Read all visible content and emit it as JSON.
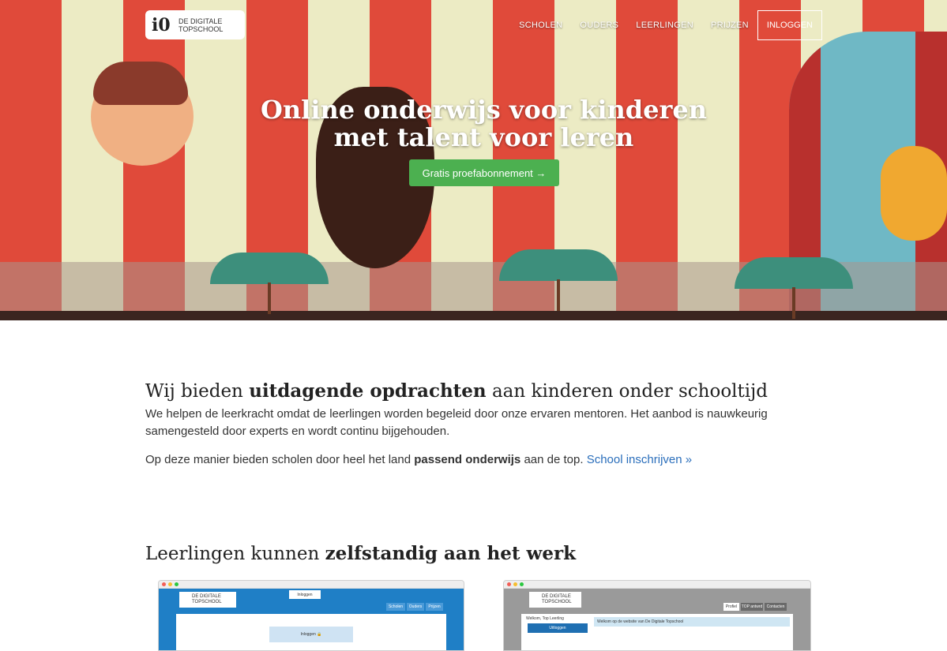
{
  "header": {
    "logo_mark": "i0",
    "logo_line1": "DE DIGITALE",
    "logo_line2": "TOPSCHOOL",
    "nav": [
      "SCHOLEN",
      "OUDERS",
      "LEERLINGEN",
      "PRIJZEN"
    ],
    "login_label": "INLOGGEN"
  },
  "hero": {
    "title": "Online onderwijs voor kinderen met talent voor leren",
    "cta_label": "Gratis proefabonnement →"
  },
  "section1": {
    "heading_pre": "Wij bieden ",
    "heading_bold": "uitdagende opdrachten",
    "heading_post": " aan kinderen onder schooltijd",
    "paragraph1": "We helpen de leerkracht omdat de leerlingen worden begeleid door onze ervaren mentoren. Het aanbod is nauwkeurig samengesteld door experts en wordt continu bijgehouden.",
    "p2_pre": "Op deze manier bieden scholen door heel het land ",
    "p2_bold": "passend onderwijs",
    "p2_post": " aan de top. ",
    "p2_link": "School inschrijven »"
  },
  "section2": {
    "heading_pre": "Leerlingen kunnen ",
    "heading_bold": "zelfstandig aan het werk"
  },
  "screenshot_left": {
    "logo_line1": "DE DIGITALE",
    "logo_line2": "TOPSCHOOL",
    "top_button": "Inloggen",
    "tabs": [
      "Scholen",
      "Ouders",
      "Prijzen"
    ],
    "login_box": "Inloggen 🔒"
  },
  "screenshot_right": {
    "logo_line1": "DE DIGITALE",
    "logo_line2": "TOPSCHOOL",
    "tabs": [
      "Profiel",
      "TOP antwrd",
      "Contacten"
    ],
    "sidebar_label": "Welkom, Top Leerling",
    "sidebar_button": "Uitloggen",
    "message": "Welkom op de website van De Digitale Topschool"
  },
  "colors": {
    "accent_green": "#4cb050",
    "link_blue": "#2a6ebb",
    "stripe_red": "#e04a3a",
    "stripe_cream": "#ecebc4"
  }
}
